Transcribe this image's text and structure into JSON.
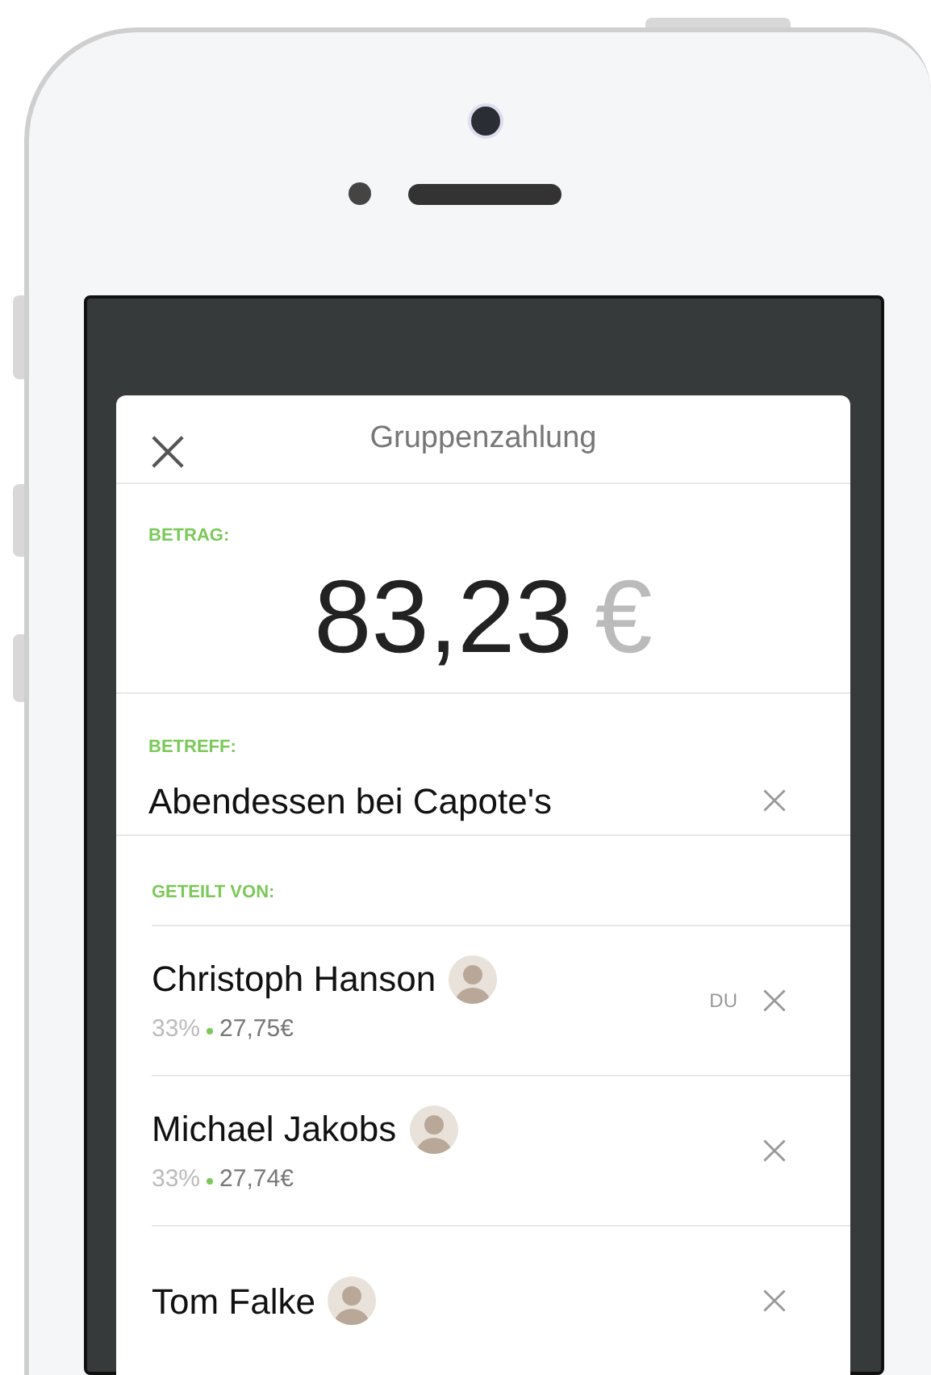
{
  "header": {
    "title": "Gruppenzahlung"
  },
  "amount": {
    "label": "BETRAG:",
    "value": "83,23",
    "currency": "€"
  },
  "subject": {
    "label": "BETREFF:",
    "value": "Abendessen bei Capote's"
  },
  "shared_by": {
    "label": "GETEILT VON:",
    "people": [
      {
        "name": "Christoph Hanson",
        "percent": "33%",
        "share": "27,75€",
        "tag": "DU"
      },
      {
        "name": "Michael Jakobs",
        "percent": "33%",
        "share": "27,74€"
      },
      {
        "name": "Tom Falke"
      }
    ]
  }
}
